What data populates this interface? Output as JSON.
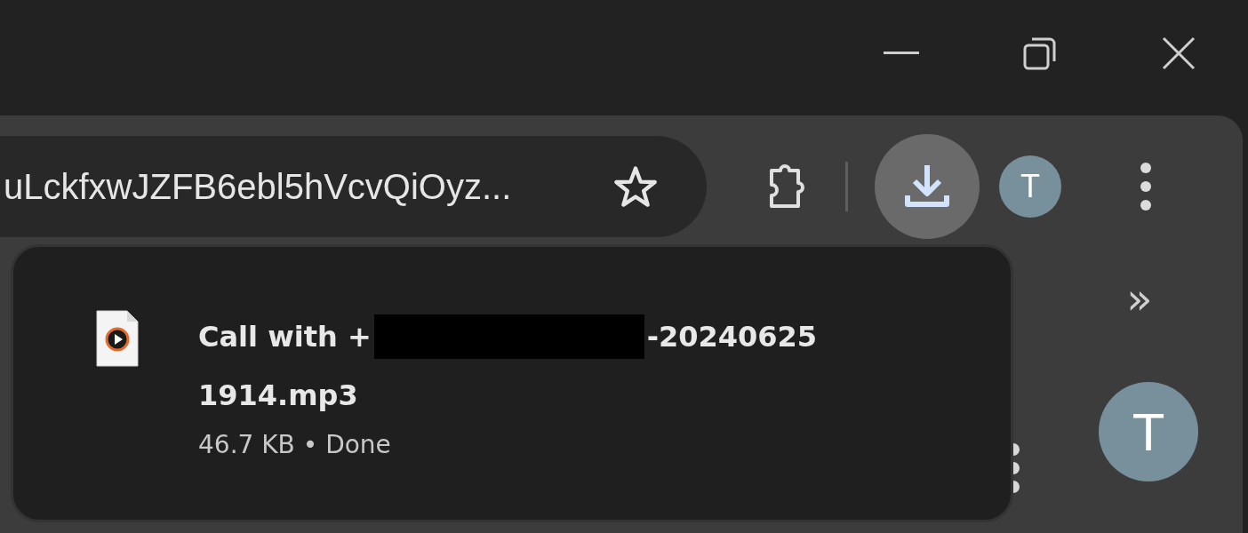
{
  "window": {
    "controls": [
      {
        "kind": "minimize"
      },
      {
        "kind": "restore"
      },
      {
        "kind": "close"
      }
    ]
  },
  "toolbar": {
    "address": "uLckfxwJZFB6ebl5hVcvQiOyz...",
    "bookmarked": false,
    "download_active": true,
    "profile_initial": "T"
  },
  "download_bubble": {
    "file": {
      "name_start": "Call with +",
      "redacted": true,
      "name_end": "-20240625",
      "name_line2": "1914.mp3",
      "status": "46.7 KB • Done"
    }
  },
  "side": {
    "overflow": "»",
    "profile_initial": "T"
  }
}
